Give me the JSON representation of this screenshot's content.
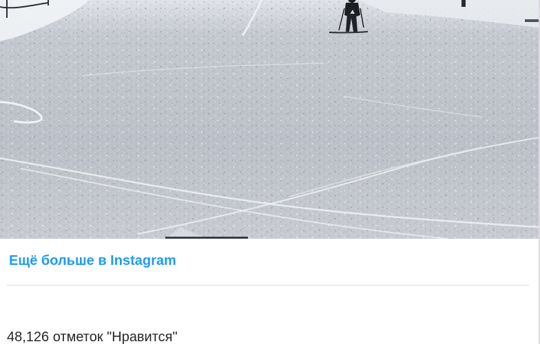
{
  "post": {
    "media": {
      "kind": "ski-slope-photo"
    },
    "more_link_label": "Ещё больше в Instagram",
    "likes_text": "48,126 отметок \"Нравится\""
  },
  "colors": {
    "link": "#1f9bf0",
    "divider": "#dbdbdb",
    "text": "#262626"
  }
}
